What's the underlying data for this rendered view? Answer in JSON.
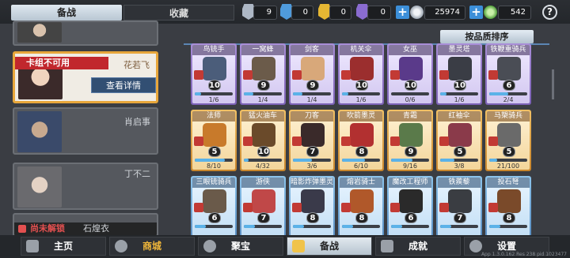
{
  "tabs": {
    "active": "备战",
    "inactive": "收藏"
  },
  "resources": [
    {
      "name": "silver-crystal",
      "value": "9",
      "color": "#aeb8c6"
    },
    {
      "name": "blue-crystal",
      "value": "0",
      "color": "#4f9bdc"
    },
    {
      "name": "gold-crystal",
      "value": "0",
      "color": "#e6b733"
    },
    {
      "name": "purple-crystal",
      "value": "0",
      "color": "#8a6cd1"
    }
  ],
  "currency": {
    "silver": "25974",
    "green": "542",
    "plus_label": "+",
    "help_label": "?"
  },
  "left_heroes": [
    {
      "name": "",
      "state": "partial"
    },
    {
      "name": "花若飞",
      "banner": "卡组不可用",
      "button": "查看详情",
      "state": "selected"
    },
    {
      "name": "肖启事",
      "state": "normal"
    },
    {
      "name": "丁不二",
      "state": "normal"
    },
    {
      "name": "石煌衣",
      "lock_text": "尚未解锁",
      "state": "locked"
    }
  ],
  "sort_label": "按品质排序",
  "cards": [
    {
      "name": "鸟铳手",
      "cost": "10",
      "count": "1/6",
      "progress": 0.17,
      "rarity": "purple",
      "color": "#4b5d7a"
    },
    {
      "name": "一窝蜂",
      "cost": "9",
      "count": "1/4",
      "progress": 0.25,
      "rarity": "purple",
      "color": "#6b5b4a"
    },
    {
      "name": "剑客",
      "cost": "9",
      "count": "1/4",
      "progress": 0.25,
      "rarity": "purple",
      "color": "#d8a87a"
    },
    {
      "name": "机关伞",
      "cost": "10",
      "count": "1/6",
      "progress": 0.17,
      "rarity": "purple",
      "color": "#9b2e2e"
    },
    {
      "name": "女巫",
      "cost": "10",
      "count": "0/6",
      "progress": 0.0,
      "rarity": "purple",
      "color": "#5a3a8a"
    },
    {
      "name": "墨灵塔",
      "cost": "10",
      "count": "1/6",
      "progress": 0.17,
      "rarity": "purple",
      "color": "#3a3d45"
    },
    {
      "name": "铁鞭重骑兵",
      "cost": "6",
      "count": "2/4",
      "progress": 0.5,
      "rarity": "purple",
      "color": "#4a4d55"
    },
    {
      "name": "法师",
      "cost": "5",
      "count": "8/10",
      "progress": 0.8,
      "rarity": "gold",
      "color": "#c87a2b"
    },
    {
      "name": "猛火油车",
      "cost": "10",
      "count": "4/32",
      "progress": 0.13,
      "rarity": "gold",
      "color": "#6a4a2a"
    },
    {
      "name": "刀客",
      "cost": "7",
      "count": "3/6",
      "progress": 0.5,
      "rarity": "gold",
      "color": "#3a2a2a"
    },
    {
      "name": "吹箭墨灵",
      "cost": "8",
      "count": "6/10",
      "progress": 0.6,
      "rarity": "gold",
      "color": "#b23030"
    },
    {
      "name": "青霜",
      "cost": "9",
      "count": "9/16",
      "progress": 0.56,
      "rarity": "gold",
      "color": "#5a7a4a"
    },
    {
      "name": "红袖伞",
      "cost": "5",
      "count": "3/8",
      "progress": 0.38,
      "rarity": "gold",
      "color": "#8a3a4a"
    },
    {
      "name": "马槊骑兵",
      "cost": "5",
      "count": "21/100",
      "progress": 0.21,
      "rarity": "gold",
      "color": "#6a6a6a"
    },
    {
      "name": "三眼铳骑兵",
      "cost": "6",
      "count": "",
      "progress": 0.3,
      "rarity": "blue",
      "color": "#6a5a4a"
    },
    {
      "name": "游侠",
      "cost": "7",
      "count": "",
      "progress": 0.3,
      "rarity": "blue",
      "color": "#c04848"
    },
    {
      "name": "暗影炸弹墨灵",
      "cost": "8",
      "count": "",
      "progress": 0.3,
      "rarity": "blue",
      "color": "#3a3a4a"
    },
    {
      "name": "熔岩骑士",
      "cost": "8",
      "count": "",
      "progress": 0.3,
      "rarity": "blue",
      "color": "#b0582a"
    },
    {
      "name": "魔改工程师",
      "cost": "6",
      "count": "",
      "progress": 0.3,
      "rarity": "blue",
      "color": "#2a2a2a"
    },
    {
      "name": "铁蒺藜",
      "cost": "7",
      "count": "",
      "progress": 0.3,
      "rarity": "blue",
      "color": "#3a3d42"
    },
    {
      "name": "投石弩",
      "cost": "8",
      "count": "",
      "progress": 0.3,
      "rarity": "blue",
      "color": "#7a4a2a"
    }
  ],
  "nav": [
    {
      "label": "主页",
      "id": "home",
      "icon": "home-icon"
    },
    {
      "label": "商城",
      "id": "shop",
      "icon": "shop-icon"
    },
    {
      "label": "聚宝",
      "id": "treasure",
      "icon": "treasure-icon"
    },
    {
      "label": "备战",
      "id": "prepare",
      "icon": "cards-icon"
    },
    {
      "label": "成就",
      "id": "achievement",
      "icon": "achievement-icon"
    },
    {
      "label": "设置",
      "id": "settings",
      "icon": "gear-icon"
    }
  ],
  "version": "App 1.3.0.162 Res 238 pid 1023477"
}
